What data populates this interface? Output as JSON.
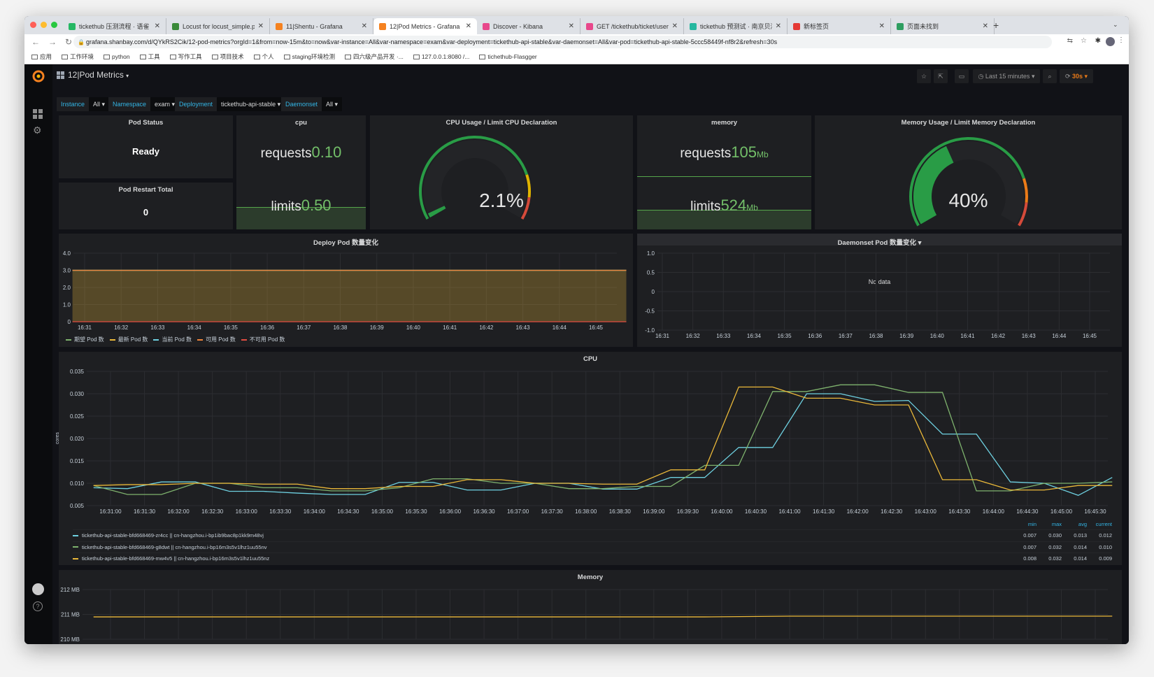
{
  "browser": {
    "tabs": [
      {
        "title": "tickethub 压测流程 · 语雀",
        "color": "#25b864"
      },
      {
        "title": "Locust for locust_simple.py",
        "color": "#3a8a3a"
      },
      {
        "title": "11|Shentu - Grafana",
        "color": "#f58220"
      },
      {
        "title": "12|Pod Metrics - Grafana",
        "color": "#f58220"
      },
      {
        "title": "Discover - Kibana",
        "color": "#e8478b"
      },
      {
        "title": "GET /tickethub/ticket/user",
        "color": "#e8478b"
      },
      {
        "title": "tickethub 预测试 · 南京贝湾信息",
        "color": "#25b8a0"
      },
      {
        "title": "新标签页",
        "color": "#e53935"
      },
      {
        "title": "页面未找到",
        "color": "#2e9e60"
      }
    ],
    "active_tab": 3,
    "url": "grafana.shanbay.com/d/QYkRS2Cik/12-pod-metrics?orgId=1&from=now-15m&to=now&var-instance=All&var-namespace=exam&var-deployment=tickethub-api-stable&var-daemonset=All&var-pod=tickethub-api-stable-5ccc58449f-nf8r2&refresh=30s",
    "bookmarks": [
      "应用",
      "工作环境",
      "python",
      "工具",
      "写作工具",
      "项目技术",
      "个人",
      "staging环境检测",
      "四六级产品开发 ·...",
      "127.0.0.1:8080 /...",
      "tichethub-Flasgger"
    ]
  },
  "dashboard": {
    "title": "12|Pod Metrics",
    "time_range": "Last 15 minutes",
    "refresh": "30s",
    "variables": [
      {
        "label": "Instance",
        "value": "All"
      },
      {
        "label": "Namespace",
        "value": "exam"
      },
      {
        "label": "Deployment",
        "value": "tickethub-api-stable"
      },
      {
        "label": "Daemonset",
        "value": "All"
      }
    ]
  },
  "panels": {
    "pod_status": {
      "title": "Pod Status",
      "value": "Ready"
    },
    "pod_restart": {
      "title": "Pod Restart Total",
      "value": "0"
    },
    "cpu": {
      "title": "cpu",
      "requests_label": "requests",
      "requests": "0.10",
      "limits_label": "limits",
      "limits": "0.50"
    },
    "cpu_gauge": {
      "title": "CPU Usage / Limit CPU Declaration",
      "value": "2.1%",
      "percent": 2.1
    },
    "memory": {
      "title": "memory",
      "requests_label": "requests",
      "requests": "105",
      "limits_label": "limits",
      "limits": "524",
      "unit": "Mb"
    },
    "mem_gauge": {
      "title": "Memory Usage / Limit Memory Declaration",
      "value": "40%",
      "percent": 40
    },
    "gauge_thresholds": {
      "green": "#299c46",
      "yellow": "#e0b400",
      "orange": "#eb7b18",
      "red": "#d44a3a"
    }
  },
  "chart_data": [
    {
      "id": "deploy",
      "type": "area",
      "title": "Deploy Pod 数量变化",
      "ylim": [
        0,
        4
      ],
      "yticks": [
        "0",
        "1.0",
        "2.0",
        "3.0",
        "4.0"
      ],
      "xticks": [
        "16:31",
        "16:32",
        "16:33",
        "16:34",
        "16:35",
        "16:36",
        "16:37",
        "16:38",
        "16:39",
        "16:40",
        "16:41",
        "16:42",
        "16:43",
        "16:44",
        "16:45"
      ],
      "x": [
        "16:30:40",
        "16:45:50"
      ],
      "series": [
        {
          "name": "期望 Pod 数",
          "color": "#7eb26d",
          "values": [
            3,
            3
          ]
        },
        {
          "name": "最新 Pod 数",
          "color": "#eab839",
          "values": [
            3,
            3
          ]
        },
        {
          "name": "当前 Pod 数",
          "color": "#6ed0e0",
          "values": [
            3,
            3
          ]
        },
        {
          "name": "可用 Pod 数",
          "color": "#ef843c",
          "values": [
            3,
            3
          ]
        },
        {
          "name": "不可用 Pod 数",
          "color": "#e24d42",
          "values": [
            0,
            0
          ]
        }
      ]
    },
    {
      "id": "daemonset",
      "type": "line",
      "title": "Daemonset Pod 数量变化",
      "ylim": [
        -1,
        1
      ],
      "no_data": "No data",
      "yticks": [
        "-1.0",
        "-0.5",
        "0",
        "0.5",
        "1.0"
      ],
      "xticks": [
        "16:31",
        "16:32",
        "16:33",
        "16:34",
        "16:35",
        "16:36",
        "16:37",
        "16:38",
        "16:39",
        "16:40",
        "16:41",
        "16:42",
        "16:43",
        "16:44",
        "16:45"
      ],
      "series": []
    },
    {
      "id": "cpu",
      "type": "line",
      "title": "CPU",
      "ylabel": "cores",
      "ylim": [
        0.005,
        0.035
      ],
      "yticks": [
        "0.005",
        "0.010",
        "0.015",
        "0.020",
        "0.025",
        "0.030",
        "0.035"
      ],
      "xticks": [
        "16:31:00",
        "16:31:30",
        "16:32:00",
        "16:32:30",
        "16:33:00",
        "16:33:30",
        "16:34:00",
        "16:34:30",
        "16:35:00",
        "16:35:30",
        "16:36:00",
        "16:36:30",
        "16:37:00",
        "16:37:30",
        "16:38:00",
        "16:38:30",
        "16:39:00",
        "16:39:30",
        "16:40:00",
        "16:40:30",
        "16:41:00",
        "16:41:30",
        "16:42:00",
        "16:42:30",
        "16:43:00",
        "16:43:30",
        "16:44:00",
        "16:44:30",
        "16:45:00",
        "16:45:30"
      ],
      "x_start": "16:30:45",
      "x_step_seconds": 30,
      "legend_columns": [
        "min",
        "max",
        "avg",
        "current"
      ],
      "series": [
        {
          "name": "tickethub-api-stable-bfd668469-zr4cc || cn-hangzhou.i-bp1ib9bac8p1kk9m48vj",
          "color": "#6ed0e0",
          "min": "0.007",
          "max": "0.030",
          "avg": "0.013",
          "current": "0.012",
          "values": [
            0.009,
            0.0088,
            0.0103,
            0.0103,
            0.0082,
            0.0082,
            0.0078,
            0.0075,
            0.0075,
            0.0102,
            0.0102,
            0.0085,
            0.0085,
            0.01,
            0.01,
            0.0087,
            0.0087,
            0.0113,
            0.0113,
            0.018,
            0.018,
            0.03,
            0.03,
            0.0283,
            0.0285,
            0.021,
            0.021,
            0.0103,
            0.01,
            0.0073,
            0.0113
          ]
        },
        {
          "name": "tickethub-api-stable-bfd668469-g8dwt || cn-hangzhou.i-bp16m3s5v1lhz1uu55nv",
          "color": "#7eb26d",
          "min": "0.007",
          "max": "0.032",
          "avg": "0.014",
          "current": "0.010",
          "values": [
            0.0095,
            0.0075,
            0.0075,
            0.01,
            0.01,
            0.009,
            0.009,
            0.0083,
            0.0083,
            0.009,
            0.011,
            0.011,
            0.01,
            0.01,
            0.0088,
            0.0088,
            0.0093,
            0.0093,
            0.014,
            0.014,
            0.0305,
            0.0305,
            0.032,
            0.032,
            0.0303,
            0.0303,
            0.0083,
            0.0083,
            0.01,
            0.01,
            0.0103
          ]
        },
        {
          "name": "tickethub-api-stable-bfd668469-mw4v5 || cn-hangzhou.i-bp16m3s5v1lhz1uu55nz",
          "color": "#eab839",
          "min": "0.008",
          "max": "0.032",
          "avg": "0.014",
          "current": "0.009",
          "values": [
            0.0095,
            0.0097,
            0.0097,
            0.01,
            0.01,
            0.0098,
            0.0098,
            0.0088,
            0.0088,
            0.0093,
            0.0093,
            0.0108,
            0.0108,
            0.01,
            0.01,
            0.0098,
            0.0098,
            0.013,
            0.013,
            0.0315,
            0.0315,
            0.029,
            0.029,
            0.0275,
            0.0275,
            0.0108,
            0.0108,
            0.0085,
            0.0085,
            0.0095,
            0.0095
          ]
        }
      ]
    },
    {
      "id": "memory",
      "type": "line",
      "title": "Memory",
      "ylim": [
        210,
        212
      ],
      "yticks": [
        "210 MB",
        "211 MB",
        "212 MB"
      ],
      "series": [
        {
          "color": "#eab839",
          "x": [
            "16:30:45",
            "16:39:45",
            "16:41:00",
            "16:45:45"
          ],
          "values": [
            210.9,
            210.9,
            210.93,
            210.93
          ]
        }
      ]
    }
  ]
}
